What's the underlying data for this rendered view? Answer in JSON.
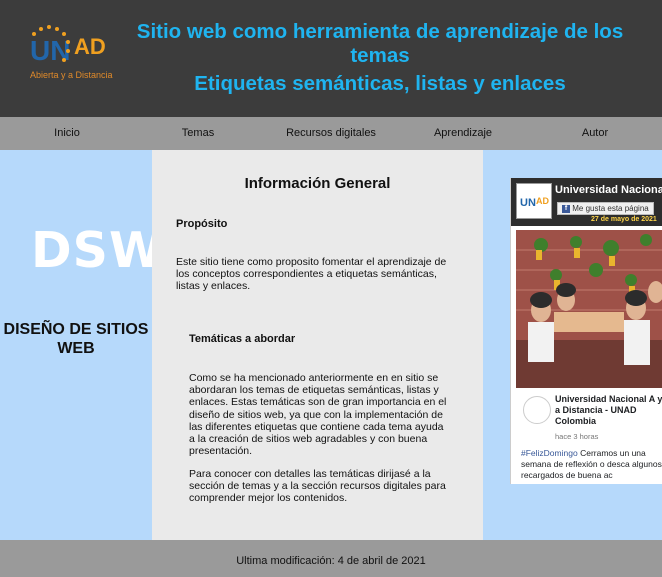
{
  "header": {
    "logo_text": "UNAD",
    "logo_tagline": "Abierta y a Distancia",
    "title_line1": "Sitio web como herramienta de aprendizaje de los temas",
    "title_line2": "Etiquetas semánticas, listas y enlaces"
  },
  "nav": {
    "items": [
      "Inicio",
      "Temas",
      "Recursos digitales",
      "Aprendizaje",
      "Autor"
    ]
  },
  "sidebar": {
    "logo": "DSW",
    "subtitle": "DISEÑO DE SITIOS WEB"
  },
  "main": {
    "title": "Información General",
    "section1_heading": "Propósito",
    "section1_text": "Este sitio tiene como proposito fomentar el aprendizaje de los conceptos correspondientes a etiquetas semánticas, listas y enlaces.",
    "section2_heading": "Temáticas a abordar",
    "section2_text1": "Como se ha mencionado anteriormente en en sitio se abordaran los temas de etiquetas semánticas, listas y enlaces. Estas temáticas son de gran importancia en el diseño de sitios web, ya que con la implementación de las diferentes etiquetas que contiene cada tema ayuda a la creación de sitios web agradables y con buena presentación.",
    "section2_text2": "Para conocer con detalles las temáticas dirijasé a la sección de temas y a la sección recursos digitales para comprender mejor los contenidos."
  },
  "facebook": {
    "page_name": "Universidad Nacional",
    "like_button": "Me gusta esta página",
    "cover_date": "27 de mayo de 2021",
    "post_author": "Universidad Nacional A y a Distancia - UNAD Colombia",
    "post_time": "hace 3 horas",
    "post_hashtag": "#FelizDomingo",
    "post_text": "Cerramos un una semana de reflexión o desca algunos, recargados de buena ac"
  },
  "footer": {
    "text": "Ultima modificación: 4 de abril de 2021"
  },
  "colors": {
    "header_bg": "#3c3c3c",
    "title_accent": "#1fb4f0",
    "nav_bg": "#9a9a9a",
    "side_bg": "#b6d9fb",
    "main_bg": "#eaeaea",
    "logo_orange": "#f0a020"
  }
}
